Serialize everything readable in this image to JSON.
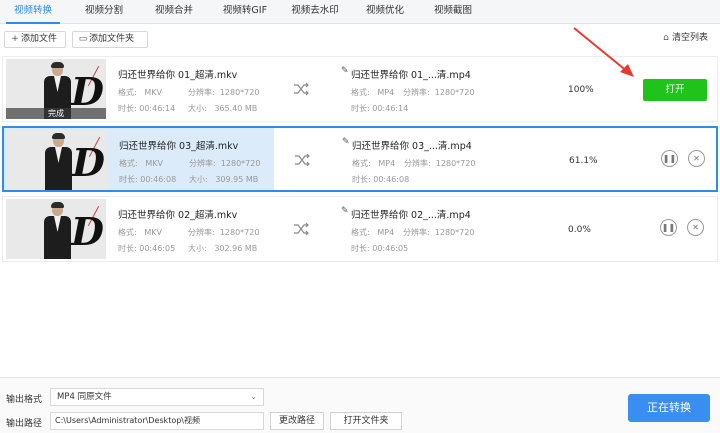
{
  "tabs": [
    "视频转换",
    "视频分割",
    "视频合并",
    "视频转GIF",
    "视频去水印",
    "视频优化",
    "视频截图"
  ],
  "toolbar": {
    "add_file": "添加文件",
    "add_folder": "添加文件夹",
    "clear_list": "清空列表"
  },
  "rows": [
    {
      "thumb_badge": "完成",
      "src_name": "归还世界给你 01_超清.mkv",
      "src_format_label": "格式:",
      "src_format": "MKV",
      "src_res_label": "分辨率:",
      "src_res": "1280*720",
      "src_dur_label": "时长:",
      "src_dur": "00:46:14",
      "src_size_label": "大小:",
      "src_size": "365.40 MB",
      "out_name": "归还世界给你 01_...清.mp4",
      "out_format_label": "格式:",
      "out_format": "MP4",
      "out_res_label": "分辨率:",
      "out_res": "1280*720",
      "out_dur_label": "时长:",
      "out_dur": "00:46:14",
      "percent": "100%",
      "open_label": "打开"
    },
    {
      "src_name": "归还世界给你 03_超清.mkv",
      "src_format_label": "格式:",
      "src_format": "MKV",
      "src_res_label": "分辨率:",
      "src_res": "1280*720",
      "src_dur_label": "时长:",
      "src_dur": "00:46:08",
      "src_size_label": "大小:",
      "src_size": "309.95 MB",
      "out_name": "归还世界给你 03_...清.mp4",
      "out_format_label": "格式:",
      "out_format": "MP4",
      "out_res_label": "分辨率:",
      "out_res": "1280*720",
      "out_dur_label": "时长:",
      "out_dur": "00:46:08",
      "percent": "61.1%",
      "progress": 0.611
    },
    {
      "src_name": "归还世界给你 02_超清.mkv",
      "src_format_label": "格式:",
      "src_format": "MKV",
      "src_res_label": "分辨率:",
      "src_res": "1280*720",
      "src_dur_label": "时长:",
      "src_dur": "00:46:05",
      "src_size_label": "大小:",
      "src_size": "302.96 MB",
      "out_name": "归还世界给你 02_...清.mp4",
      "out_format_label": "格式:",
      "out_format": "MP4",
      "out_res_label": "分辨率:",
      "out_res": "1280*720",
      "out_dur_label": "时长:",
      "out_dur": "00:46:05",
      "percent": "0.0%"
    }
  ],
  "bottom": {
    "format_label": "输出格式",
    "format_value": "MP4  同原文件",
    "path_label": "输出路径",
    "path_value": "C:\\Users\\Administrator\\Desktop\\视频",
    "change_path": "更改路径",
    "open_folder": "打开文件夹",
    "convert": "正在转换"
  },
  "colors": {
    "accent": "#2d8cf0",
    "open_green": "#1fc31a",
    "convert_blue": "#3a8ef0",
    "annotation_red": "#e8392f"
  }
}
